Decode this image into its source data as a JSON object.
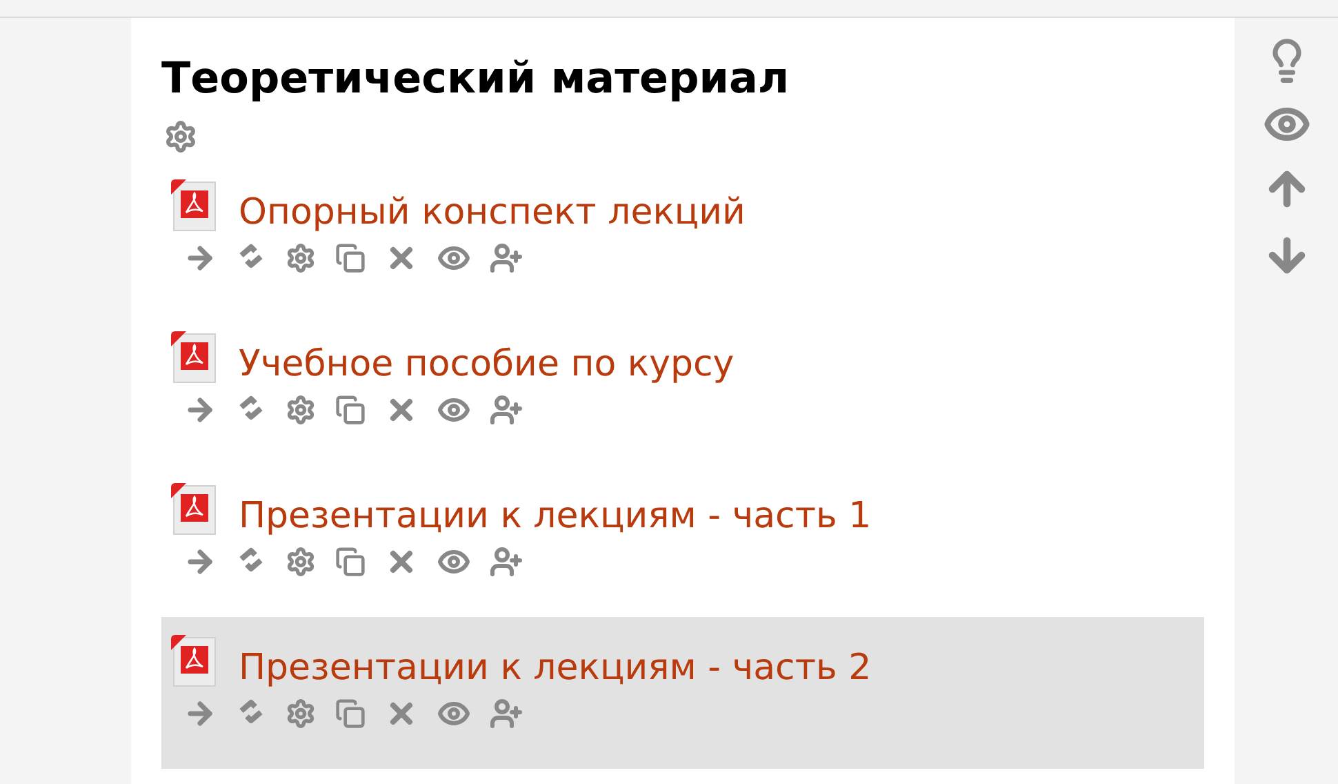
{
  "section": {
    "title": "Теоретический материал"
  },
  "items": [
    {
      "label": "Опорный конспект лекций",
      "highlighted": false
    },
    {
      "label": "Учебное пособие по курсу",
      "highlighted": false
    },
    {
      "label": "Презентации к лекциям - часть 1",
      "highlighted": false
    },
    {
      "label": "Презентации к лекциям - часть 2",
      "highlighted": true
    }
  ]
}
